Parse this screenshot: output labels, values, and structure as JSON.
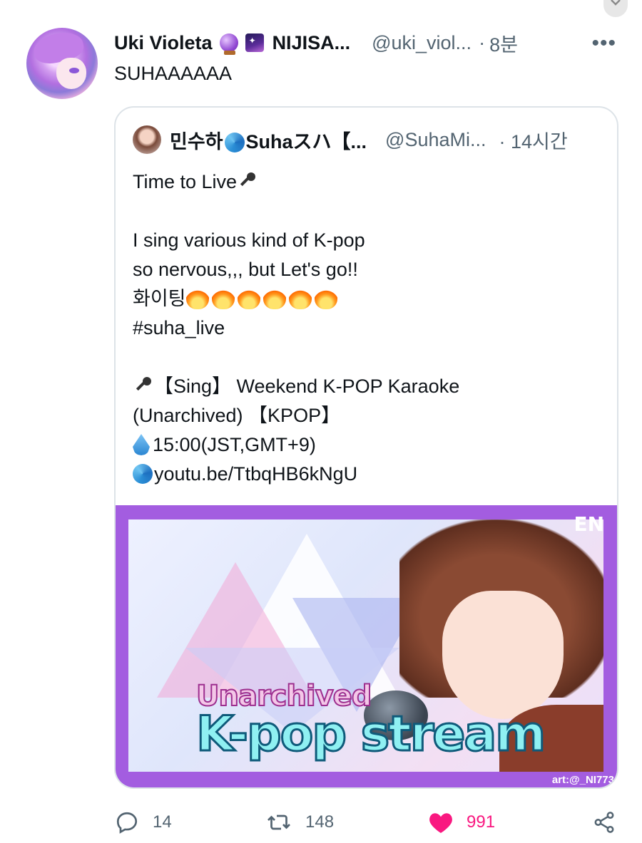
{
  "tweet": {
    "author": {
      "name": "Uki Violeta",
      "emoji_icons": [
        "crystal-ball-icon",
        "night-sky-icon"
      ],
      "org": "NIJISA...",
      "handle": "@uki_viol...",
      "separator": "·",
      "time": "8분"
    },
    "text": "SUHAAAAAA",
    "more_label": "•••"
  },
  "quote": {
    "author": {
      "name_prefix": "민수하",
      "name_suffix": "Suhaスハ【...",
      "handle": "@SuhaMi...",
      "time": "· 14시간"
    },
    "body": {
      "line1": "Time to Live",
      "line2": "I sing various kind of K-pop",
      "line3": "so nervous,,, but Let's go!!",
      "line4": "화이팅",
      "line5": "#suha_live",
      "line6": "【Sing】 Weekend K-POP Karaoke",
      "line7": "(Unarchived) 【KPOP】",
      "line8": "15:00(JST,GMT+9)",
      "line9": "youtu.be/TtbqHB6kNgU"
    },
    "thumbnail": {
      "tag": "EN",
      "title_small": "Unarchived",
      "title_large": "K-pop stream",
      "credit": "art:@_NI773"
    }
  },
  "actions": {
    "reply_count": "14",
    "retweet_count": "148",
    "like_count": "991"
  },
  "colors": {
    "like": "#f91880",
    "secondary_text": "#536471",
    "thumbnail_border": "#a35de0"
  }
}
